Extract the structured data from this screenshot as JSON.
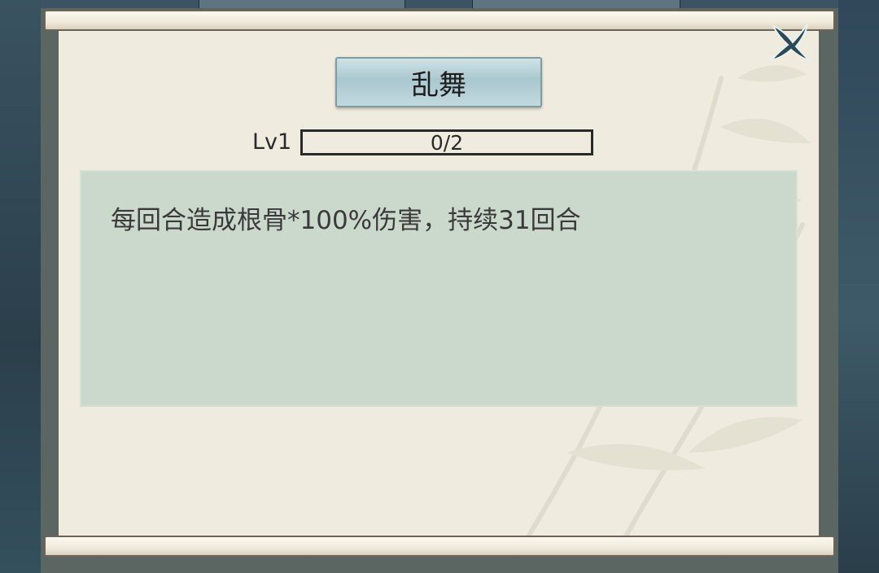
{
  "skill": {
    "name": "乱舞",
    "level_label": "Lv1",
    "progress_text": "0/2",
    "progress_value": 0,
    "description": "每回合造成根骨*100%伤害，持续31回合"
  },
  "icons": {
    "close": "close-x-icon",
    "decoration": "bamboo-leaves"
  },
  "colors": {
    "panel_bg": "#efebdf",
    "desc_bg": "#cbd9cc",
    "button_bg": "#b7d0d5",
    "frame": "#5b6663"
  }
}
